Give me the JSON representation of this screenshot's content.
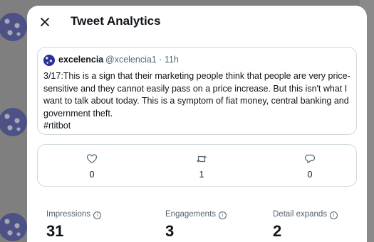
{
  "modal": {
    "title": "Tweet Analytics"
  },
  "tweet": {
    "author_name": "excelencia",
    "author_handle": "@xcelencia1 · 11h",
    "text_lines": [
      "3/17:This is a sign that their marketing people think that people are very price-",
      "sensitive and they cannot easily pass on a price increase. But this isn't what I",
      "want to talk about today. This is a symptom of fiat money, central banking and",
      "government theft.",
      "#rtitbot"
    ]
  },
  "engagement": {
    "likes": "0",
    "retweets": "1",
    "replies": "0"
  },
  "metrics": [
    {
      "label": "Impressions",
      "value": "31"
    },
    {
      "label": "Engagements",
      "value": "3"
    },
    {
      "label": "Detail expands",
      "value": "2"
    }
  ],
  "icons": {
    "close": "close-icon",
    "like": "heart-icon",
    "retweet": "retweet-icon",
    "reply": "reply-icon",
    "info": "info-icon"
  },
  "colors": {
    "text": "#0f1419",
    "secondary_text": "#536471",
    "border": "#cfd9de",
    "overlay": "#7f7f7f"
  }
}
